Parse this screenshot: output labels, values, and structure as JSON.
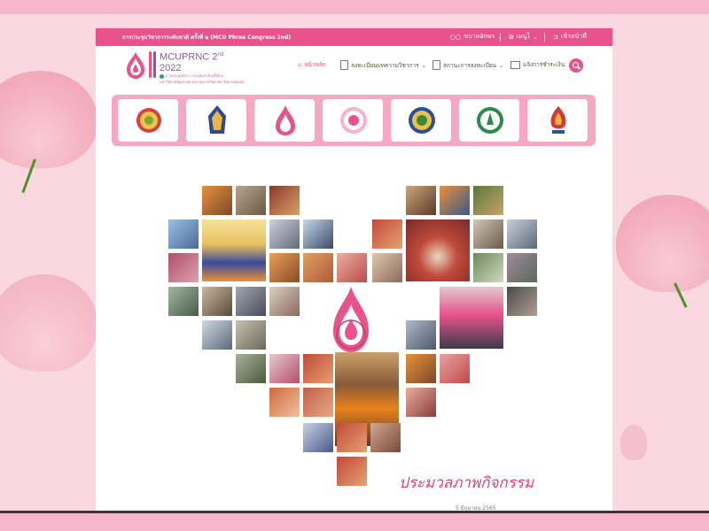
{
  "topbar": {
    "title": "การประชุมวิชาการระดับชาติ ครั้งที่ ๒ (MCU Phrae Congress 2nd)",
    "font_size_label": "ขนาดอักษร",
    "language_label": "เมนูไ",
    "login_label": "เข้าหน้าที่"
  },
  "logo": {
    "title_line1": "MCUPRNC 2",
    "title_sup": "nd",
    "title_line2": "2022",
    "subtitle_line1": "การประชุมวิชาการระดับชาติ ครั้งที่ ๒",
    "subtitle_line2": "มหาวิทยาลัยมหาจุฬาลงกรณราชวิทยาลัย วิทยาเขตแพร่"
  },
  "nav": {
    "home": "หน้าหลัก",
    "register": "ลงทะเบียนบทความวิชาการ",
    "status": "สถานะการลงทะเบียน",
    "payment": "แจ้งการชำระเงิน"
  },
  "partners": [
    "partner-seal-1",
    "partner-seal-2",
    "partner-seal-3",
    "partner-seal-4",
    "partner-seal-5",
    "partner-seal-6",
    "partner-seal-7"
  ],
  "activity": {
    "title": "ประมวลภาพกิจกรรม",
    "date": "5 มิถุนายน 2565"
  },
  "colors": {
    "accent": "#e9538c",
    "partner_bar": "#f6a8c0",
    "background": "#f9d9df"
  }
}
